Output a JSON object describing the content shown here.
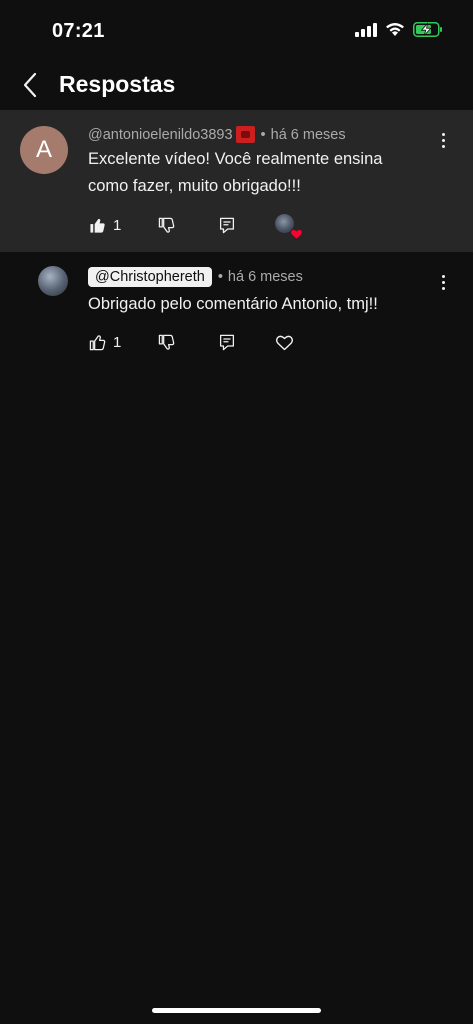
{
  "status_bar": {
    "time": "07:21",
    "icons": [
      "cellular-signal-icon",
      "wifi-icon",
      "battery-charging-icon"
    ],
    "battery_color": "#34c759"
  },
  "header": {
    "back_icon": "chevron-left-icon",
    "title": "Respostas"
  },
  "parent_comment": {
    "avatar_letter": "A",
    "avatar_color": "#a47b6d",
    "author": "@antonioelenildo3893",
    "separator": "•",
    "time": "há 6 meses",
    "text_line1": "Excelente vídeo! Você realmente ensina",
    "text_line2": "como fazer, muito obrigado!!!",
    "likes": "1",
    "liked": true,
    "creator_hearted": true
  },
  "reply": {
    "author": "@Christophereth",
    "separator": "•",
    "time": "há 6 meses",
    "text": "Obrigado pelo comentário Antonio, tmj!!",
    "likes": "1",
    "liked": false
  },
  "colors": {
    "background": "#0f0f0f",
    "highlight": "#272727",
    "heart": "#ff0033"
  }
}
